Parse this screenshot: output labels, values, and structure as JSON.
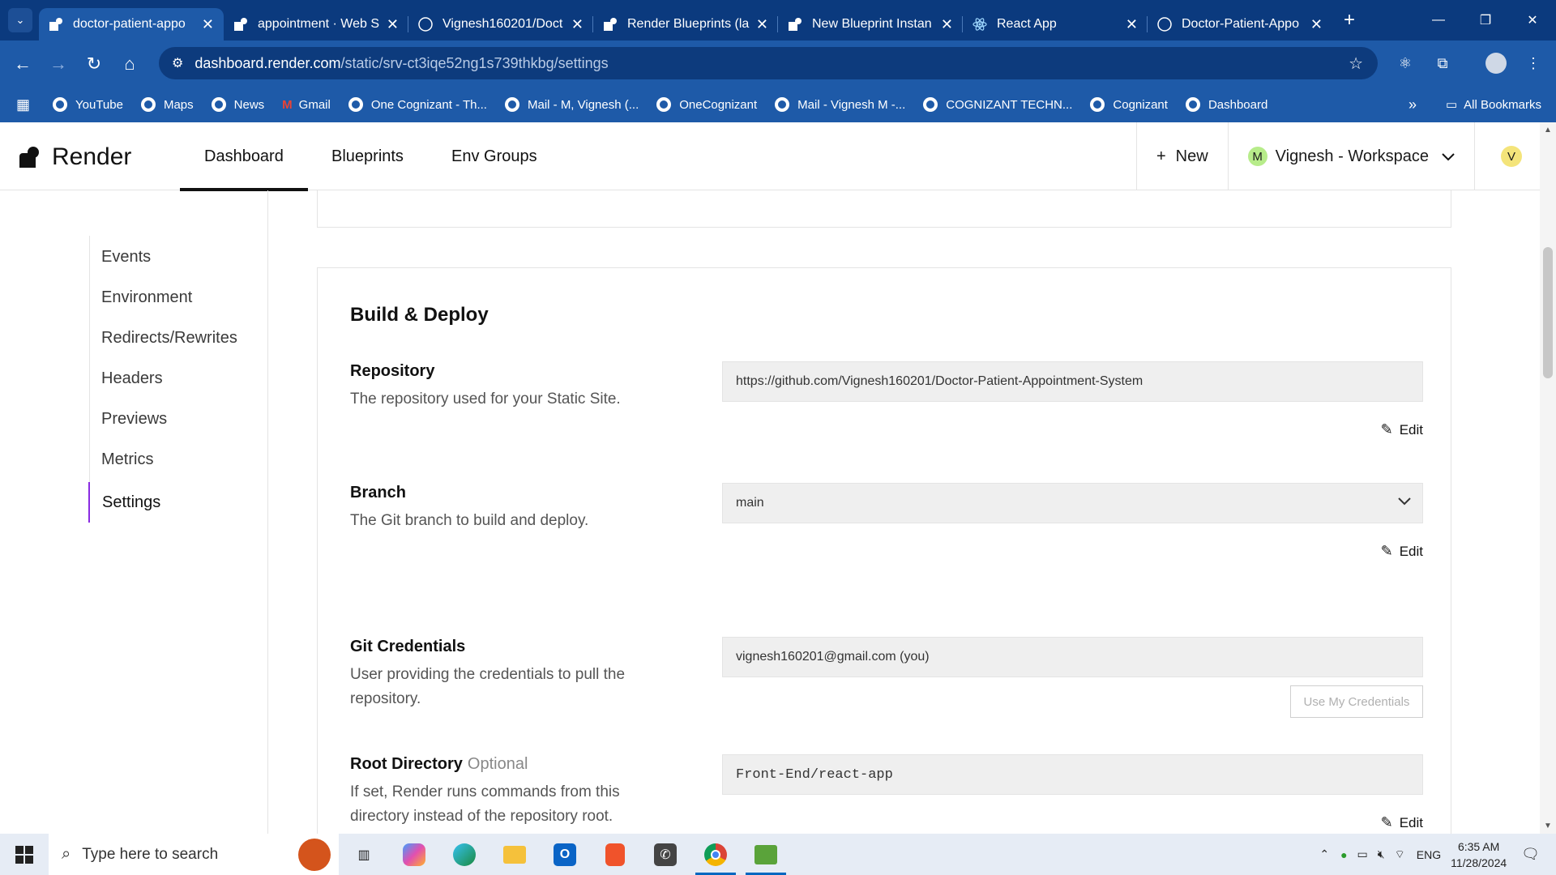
{
  "browser": {
    "tabs": [
      {
        "title": "doctor-patient-appo",
        "active": true
      },
      {
        "title": "appointment · Web S"
      },
      {
        "title": "Vignesh160201/Doct"
      },
      {
        "title": "Render Blueprints (la"
      },
      {
        "title": "New Blueprint Instan"
      },
      {
        "title": "React App"
      },
      {
        "title": "Doctor-Patient-Appo"
      }
    ],
    "url_host": "dashboard.render.com",
    "url_path": "/static/srv-ct3iqe52ng1s739thkbg/settings",
    "bookmarks": [
      "YouTube",
      "Maps",
      "News",
      "Gmail",
      "One Cognizant - Th...",
      "Mail - M, Vignesh (...",
      "OneCognizant",
      "Mail - Vignesh M -...",
      "COGNIZANT TECHN...",
      "Cognizant",
      "Dashboard"
    ],
    "all_bookmarks": "All Bookmarks"
  },
  "header": {
    "logo": "Render",
    "nav": [
      "Dashboard",
      "Blueprints",
      "Env Groups"
    ],
    "new_label": "New",
    "workspace_initial": "M",
    "workspace": "Vignesh - Workspace",
    "user_initial": "V"
  },
  "sidebar": {
    "items": [
      "Events",
      "Environment",
      "Redirects/Rewrites",
      "Headers",
      "Previews",
      "Metrics",
      "Settings"
    ],
    "active": "Settings"
  },
  "build_deploy": {
    "title": "Build & Deploy",
    "repository": {
      "label": "Repository",
      "desc": "The repository used for your Static Site.",
      "value": "https://github.com/Vignesh160201/Doctor-Patient-Appointment-System",
      "edit": "Edit"
    },
    "branch": {
      "label": "Branch",
      "desc": "The Git branch to build and deploy.",
      "value": "main",
      "edit": "Edit"
    },
    "git_credentials": {
      "label": "Git Credentials",
      "desc": "User providing the credentials to pull the repository.",
      "value": "vignesh160201@gmail.com (you)",
      "button": "Use My Credentials"
    },
    "root_directory": {
      "label": "Root Directory",
      "optional": "Optional",
      "desc": "If set, Render runs commands from this directory instead of the repository root.",
      "value": "Front-End/react-app",
      "edit": "Edit"
    }
  },
  "taskbar": {
    "search_placeholder": "Type here to search",
    "lang": "ENG",
    "time": "6:35 AM",
    "date": "11/28/2024"
  }
}
